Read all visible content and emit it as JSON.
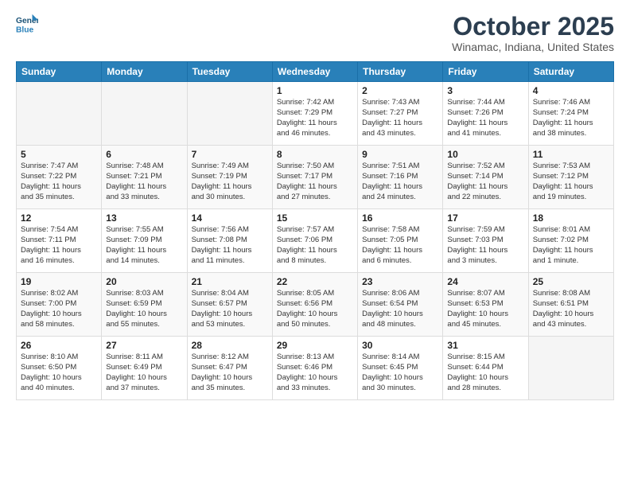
{
  "header": {
    "logo_line1": "General",
    "logo_line2": "Blue",
    "month": "October 2025",
    "location": "Winamac, Indiana, United States"
  },
  "weekdays": [
    "Sunday",
    "Monday",
    "Tuesday",
    "Wednesday",
    "Thursday",
    "Friday",
    "Saturday"
  ],
  "weeks": [
    [
      {
        "day": "",
        "info": ""
      },
      {
        "day": "",
        "info": ""
      },
      {
        "day": "",
        "info": ""
      },
      {
        "day": "1",
        "info": "Sunrise: 7:42 AM\nSunset: 7:29 PM\nDaylight: 11 hours\nand 46 minutes."
      },
      {
        "day": "2",
        "info": "Sunrise: 7:43 AM\nSunset: 7:27 PM\nDaylight: 11 hours\nand 43 minutes."
      },
      {
        "day": "3",
        "info": "Sunrise: 7:44 AM\nSunset: 7:26 PM\nDaylight: 11 hours\nand 41 minutes."
      },
      {
        "day": "4",
        "info": "Sunrise: 7:46 AM\nSunset: 7:24 PM\nDaylight: 11 hours\nand 38 minutes."
      }
    ],
    [
      {
        "day": "5",
        "info": "Sunrise: 7:47 AM\nSunset: 7:22 PM\nDaylight: 11 hours\nand 35 minutes."
      },
      {
        "day": "6",
        "info": "Sunrise: 7:48 AM\nSunset: 7:21 PM\nDaylight: 11 hours\nand 33 minutes."
      },
      {
        "day": "7",
        "info": "Sunrise: 7:49 AM\nSunset: 7:19 PM\nDaylight: 11 hours\nand 30 minutes."
      },
      {
        "day": "8",
        "info": "Sunrise: 7:50 AM\nSunset: 7:17 PM\nDaylight: 11 hours\nand 27 minutes."
      },
      {
        "day": "9",
        "info": "Sunrise: 7:51 AM\nSunset: 7:16 PM\nDaylight: 11 hours\nand 24 minutes."
      },
      {
        "day": "10",
        "info": "Sunrise: 7:52 AM\nSunset: 7:14 PM\nDaylight: 11 hours\nand 22 minutes."
      },
      {
        "day": "11",
        "info": "Sunrise: 7:53 AM\nSunset: 7:12 PM\nDaylight: 11 hours\nand 19 minutes."
      }
    ],
    [
      {
        "day": "12",
        "info": "Sunrise: 7:54 AM\nSunset: 7:11 PM\nDaylight: 11 hours\nand 16 minutes."
      },
      {
        "day": "13",
        "info": "Sunrise: 7:55 AM\nSunset: 7:09 PM\nDaylight: 11 hours\nand 14 minutes."
      },
      {
        "day": "14",
        "info": "Sunrise: 7:56 AM\nSunset: 7:08 PM\nDaylight: 11 hours\nand 11 minutes."
      },
      {
        "day": "15",
        "info": "Sunrise: 7:57 AM\nSunset: 7:06 PM\nDaylight: 11 hours\nand 8 minutes."
      },
      {
        "day": "16",
        "info": "Sunrise: 7:58 AM\nSunset: 7:05 PM\nDaylight: 11 hours\nand 6 minutes."
      },
      {
        "day": "17",
        "info": "Sunrise: 7:59 AM\nSunset: 7:03 PM\nDaylight: 11 hours\nand 3 minutes."
      },
      {
        "day": "18",
        "info": "Sunrise: 8:01 AM\nSunset: 7:02 PM\nDaylight: 11 hours\nand 1 minute."
      }
    ],
    [
      {
        "day": "19",
        "info": "Sunrise: 8:02 AM\nSunset: 7:00 PM\nDaylight: 10 hours\nand 58 minutes."
      },
      {
        "day": "20",
        "info": "Sunrise: 8:03 AM\nSunset: 6:59 PM\nDaylight: 10 hours\nand 55 minutes."
      },
      {
        "day": "21",
        "info": "Sunrise: 8:04 AM\nSunset: 6:57 PM\nDaylight: 10 hours\nand 53 minutes."
      },
      {
        "day": "22",
        "info": "Sunrise: 8:05 AM\nSunset: 6:56 PM\nDaylight: 10 hours\nand 50 minutes."
      },
      {
        "day": "23",
        "info": "Sunrise: 8:06 AM\nSunset: 6:54 PM\nDaylight: 10 hours\nand 48 minutes."
      },
      {
        "day": "24",
        "info": "Sunrise: 8:07 AM\nSunset: 6:53 PM\nDaylight: 10 hours\nand 45 minutes."
      },
      {
        "day": "25",
        "info": "Sunrise: 8:08 AM\nSunset: 6:51 PM\nDaylight: 10 hours\nand 43 minutes."
      }
    ],
    [
      {
        "day": "26",
        "info": "Sunrise: 8:10 AM\nSunset: 6:50 PM\nDaylight: 10 hours\nand 40 minutes."
      },
      {
        "day": "27",
        "info": "Sunrise: 8:11 AM\nSunset: 6:49 PM\nDaylight: 10 hours\nand 37 minutes."
      },
      {
        "day": "28",
        "info": "Sunrise: 8:12 AM\nSunset: 6:47 PM\nDaylight: 10 hours\nand 35 minutes."
      },
      {
        "day": "29",
        "info": "Sunrise: 8:13 AM\nSunset: 6:46 PM\nDaylight: 10 hours\nand 33 minutes."
      },
      {
        "day": "30",
        "info": "Sunrise: 8:14 AM\nSunset: 6:45 PM\nDaylight: 10 hours\nand 30 minutes."
      },
      {
        "day": "31",
        "info": "Sunrise: 8:15 AM\nSunset: 6:44 PM\nDaylight: 10 hours\nand 28 minutes."
      },
      {
        "day": "",
        "info": ""
      }
    ]
  ]
}
